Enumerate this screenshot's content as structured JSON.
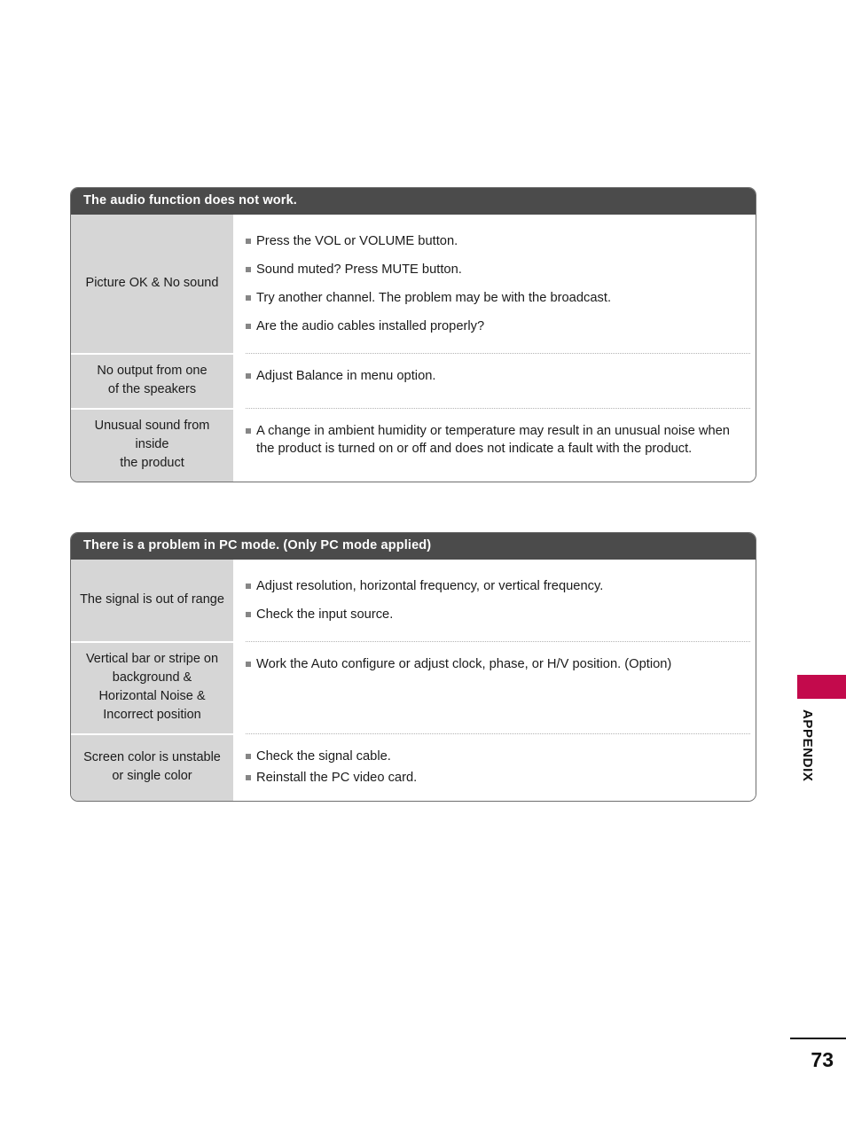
{
  "page": {
    "number": "73",
    "side_tab_label": "APPENDIX",
    "accent_color": "#c30a4c",
    "header_bg": "#4b4b4b",
    "symptom_bg": "#d6d6d6"
  },
  "tables": [
    {
      "header": "The audio function does not work.",
      "rows": [
        {
          "symptom_lines": [
            "Picture OK & No sound"
          ],
          "fixes": [
            "Press the VOL or VOLUME button.",
            "Sound muted? Press MUTE button.",
            "Try another channel. The problem may be with the broadcast.",
            "Are the audio cables installed properly?"
          ]
        },
        {
          "symptom_lines": [
            "No output from one",
            "of the speakers"
          ],
          "fixes": [
            "Adjust Balance in menu option."
          ]
        },
        {
          "symptom_lines": [
            "Unusual sound from",
            "inside",
            "the product"
          ],
          "fixes": [
            "A change in ambient humidity or temperature may result in an unusual noise when the product is turned on or off and does not indicate a fault with the product."
          ]
        }
      ]
    },
    {
      "header": "There is a problem in PC mode. (Only PC mode applied)",
      "rows": [
        {
          "symptom_lines": [
            "The signal is out of range"
          ],
          "fixes": [
            "Adjust resolution, horizontal frequency, or vertical frequency.",
            "Check the input source."
          ]
        },
        {
          "symptom_lines": [
            "Vertical bar or stripe on",
            "background &",
            "Horizontal Noise &",
            "Incorrect position"
          ],
          "fixes": [
            "Work the Auto configure or adjust clock, phase, or H/V position. (Option)"
          ]
        },
        {
          "symptom_lines": [
            "Screen color is unstable",
            "or single color"
          ],
          "fixes": [
            "Check the signal cable.",
            "Reinstall the PC video card."
          ]
        }
      ]
    }
  ]
}
